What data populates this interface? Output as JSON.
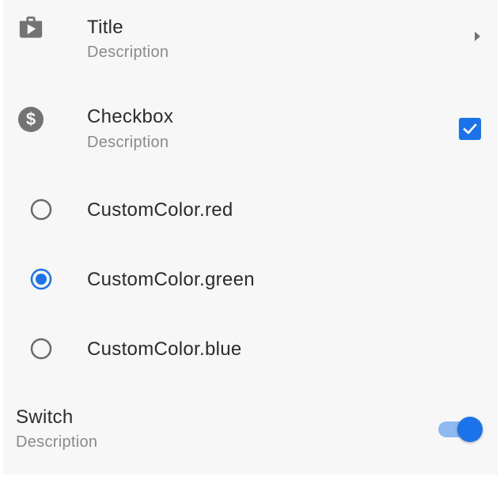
{
  "colors": {
    "accent": "#1a73e8",
    "accent_light": "#8fb9f2",
    "icon_gray": "#737373",
    "radio_gray": "#6b6b6b",
    "background": "#f7f7f7"
  },
  "title_row": {
    "icon": "shop-icon",
    "title": "Title",
    "description": "Description",
    "trailing_icon": "arrow-right-icon"
  },
  "checkbox_row": {
    "icon": "dollar-icon",
    "title": "Checkbox",
    "description": "Description",
    "checked": true
  },
  "radio_group": {
    "options": [
      {
        "label": "CustomColor.red",
        "selected": false
      },
      {
        "label": "CustomColor.green",
        "selected": true
      },
      {
        "label": "CustomColor.blue",
        "selected": false
      }
    ]
  },
  "switch_row": {
    "title": "Switch",
    "description": "Description",
    "on": true
  }
}
